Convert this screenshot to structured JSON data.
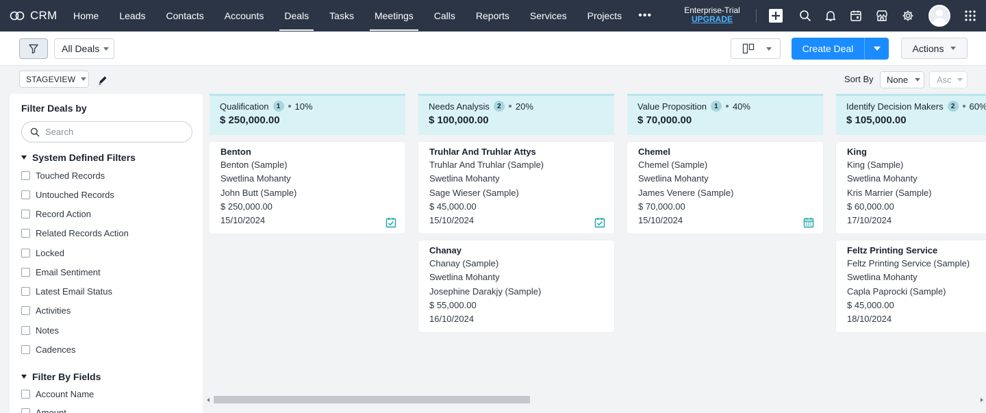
{
  "brand": {
    "name": "CRM"
  },
  "nav": {
    "items": [
      {
        "label": "Home",
        "active": false
      },
      {
        "label": "Leads",
        "active": false
      },
      {
        "label": "Contacts",
        "active": false
      },
      {
        "label": "Accounts",
        "active": false
      },
      {
        "label": "Deals",
        "active": true
      },
      {
        "label": "Tasks",
        "active": false
      },
      {
        "label": "Meetings",
        "active": true
      },
      {
        "label": "Calls",
        "active": false
      },
      {
        "label": "Reports",
        "active": false
      },
      {
        "label": "Services",
        "active": false
      },
      {
        "label": "Projects",
        "active": false
      }
    ],
    "more": "•••",
    "trial_label": "Enterprise-Trial",
    "upgrade_label": "UPGRADE"
  },
  "toolbar": {
    "view_name": "All Deals",
    "create_label": "Create Deal",
    "actions_label": "Actions"
  },
  "subbar": {
    "stageview_label": "STAGEVIEW",
    "sort_by_label": "Sort By",
    "sort_field": "None",
    "sort_order": "Asc"
  },
  "sidebar": {
    "title": "Filter Deals by",
    "search_placeholder": "Search",
    "system_section": "System Defined Filters",
    "system_filters": [
      "Touched Records",
      "Untouched Records",
      "Record Action",
      "Related Records Action",
      "Locked",
      "Email Sentiment",
      "Latest Email Status",
      "Activities",
      "Notes",
      "Cadences"
    ],
    "fields_section": "Filter By Fields",
    "field_filters": [
      "Account Name",
      "Amount"
    ]
  },
  "board": {
    "columns": [
      {
        "name": "Qualification",
        "count": "1",
        "probability": "10%",
        "amount": "$ 250,000.00",
        "cards": [
          {
            "title": "Benton",
            "account": "Benton (Sample)",
            "owner": "Swetlina Mohanty",
            "contact": "John Butt (Sample)",
            "amount": "$ 250,000.00",
            "date": "15/10/2024",
            "icon": "task-check-icon"
          }
        ]
      },
      {
        "name": "Needs Analysis",
        "count": "2",
        "probability": "20%",
        "amount": "$ 100,000.00",
        "cards": [
          {
            "title": "Truhlar And Truhlar Attys",
            "account": "Truhlar And Truhlar (Sample)",
            "owner": "Swetlina Mohanty",
            "contact": "Sage Wieser (Sample)",
            "amount": "$ 45,000.00",
            "date": "15/10/2024",
            "icon": "task-check-icon"
          },
          {
            "title": "Chanay",
            "account": "Chanay (Sample)",
            "owner": "Swetlina Mohanty",
            "contact": "Josephine Darakjy (Sample)",
            "amount": "$ 55,000.00",
            "date": "16/10/2024",
            "icon": ""
          }
        ]
      },
      {
        "name": "Value Proposition",
        "count": "1",
        "probability": "40%",
        "amount": "$ 70,000.00",
        "cards": [
          {
            "title": "Chemel",
            "account": "Chemel (Sample)",
            "owner": "Swetlina Mohanty",
            "contact": "James Venere (Sample)",
            "amount": "$ 70,000.00",
            "date": "15/10/2024",
            "icon": "calendar-icon"
          }
        ]
      },
      {
        "name": "Identify Decision Makers",
        "count": "2",
        "probability": "60%",
        "amount": "$ 105,000.00",
        "cards": [
          {
            "title": "King",
            "account": "King (Sample)",
            "owner": "Swetlina Mohanty",
            "contact": "Kris Marrier (Sample)",
            "amount": "$ 60,000.00",
            "date": "17/10/2024",
            "icon": ""
          },
          {
            "title": "Feltz Printing Service",
            "account": "Feltz Printing Service (Sample)",
            "owner": "Swetlina Mohanty",
            "contact": "Capla Paprocki (Sample)",
            "amount": "$ 45,000.00",
            "date": "18/10/2024",
            "icon": ""
          }
        ]
      }
    ]
  },
  "colors": {
    "nav_bg": "#2b3546",
    "accent": "#1a8cff",
    "stage_header": "#d9f2f6",
    "upgrade": "#4fb3ff",
    "task_icon": "#1aa4a4"
  }
}
